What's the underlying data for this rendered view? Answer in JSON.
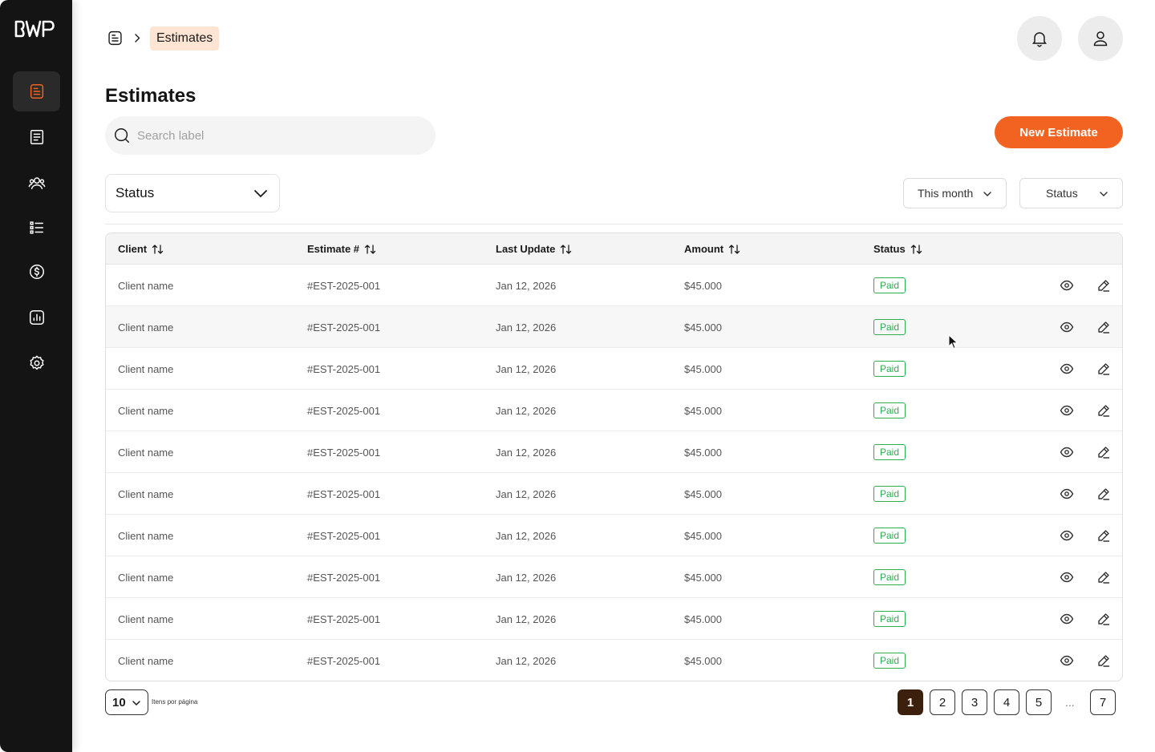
{
  "sidebar": {
    "logo_text": "BWP",
    "items": [
      {
        "icon": "document-list-icon",
        "active": true
      },
      {
        "icon": "receipt-icon",
        "active": false
      },
      {
        "icon": "users-icon",
        "active": false
      },
      {
        "icon": "checklist-icon",
        "active": false
      },
      {
        "icon": "dollar-icon",
        "active": false
      },
      {
        "icon": "chart-icon",
        "active": false
      },
      {
        "icon": "gear-icon",
        "active": false
      }
    ],
    "accent_color": "#f26322"
  },
  "breadcrumb": {
    "current": "Estimates"
  },
  "page": {
    "title": "Estimates"
  },
  "search": {
    "placeholder": "Search label"
  },
  "toolbar": {
    "new_label": "New Estimate",
    "status_select": "Status",
    "date_filter": "This month",
    "status_filter": "Status"
  },
  "table": {
    "columns": [
      "Client",
      "Estimate #",
      "Last Update",
      "Amount",
      "Status"
    ],
    "rows": [
      {
        "client": "Client name",
        "estimate": "#EST-2025-001",
        "updated": "Jan 12, 2026",
        "amount": "$45.000",
        "status": "Paid"
      },
      {
        "client": "Client name",
        "estimate": "#EST-2025-001",
        "updated": "Jan 12, 2026",
        "amount": "$45.000",
        "status": "Paid"
      },
      {
        "client": "Client name",
        "estimate": "#EST-2025-001",
        "updated": "Jan 12, 2026",
        "amount": "$45.000",
        "status": "Paid"
      },
      {
        "client": "Client name",
        "estimate": "#EST-2025-001",
        "updated": "Jan 12, 2026",
        "amount": "$45.000",
        "status": "Paid"
      },
      {
        "client": "Client name",
        "estimate": "#EST-2025-001",
        "updated": "Jan 12, 2026",
        "amount": "$45.000",
        "status": "Paid"
      },
      {
        "client": "Client name",
        "estimate": "#EST-2025-001",
        "updated": "Jan 12, 2026",
        "amount": "$45.000",
        "status": "Paid"
      },
      {
        "client": "Client name",
        "estimate": "#EST-2025-001",
        "updated": "Jan 12, 2026",
        "amount": "$45.000",
        "status": "Paid"
      },
      {
        "client": "Client name",
        "estimate": "#EST-2025-001",
        "updated": "Jan 12, 2026",
        "amount": "$45.000",
        "status": "Paid"
      },
      {
        "client": "Client name",
        "estimate": "#EST-2025-001",
        "updated": "Jan 12, 2026",
        "amount": "$45.000",
        "status": "Paid"
      },
      {
        "client": "Client name",
        "estimate": "#EST-2025-001",
        "updated": "Jan 12, 2026",
        "amount": "$45.000",
        "status": "Paid"
      }
    ],
    "status_color": "#2eae4f"
  },
  "pagination": {
    "per_page": "10",
    "per_page_label": "Itens por página",
    "pages": [
      "1",
      "2",
      "3",
      "4",
      "5",
      "7"
    ],
    "current": "1",
    "ellipsis": "..."
  }
}
